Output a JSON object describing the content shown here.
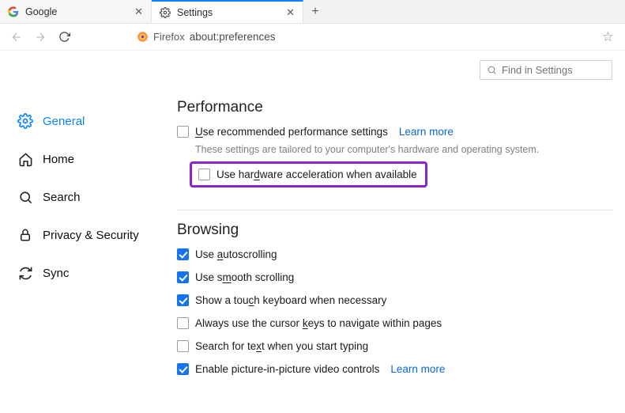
{
  "tabs": [
    {
      "label": "Google",
      "icon": "google"
    },
    {
      "label": "Settings",
      "icon": "gear"
    }
  ],
  "toolbar": {
    "identity_label": "Firefox",
    "url": "about:preferences"
  },
  "find_placeholder": "Find in Settings",
  "sidebar": {
    "items": [
      {
        "label": "General"
      },
      {
        "label": "Home"
      },
      {
        "label": "Search"
      },
      {
        "label": "Privacy & Security"
      },
      {
        "label": "Sync"
      }
    ]
  },
  "performance": {
    "title": "Performance",
    "recommended_label_pre": "",
    "recommended_u": "U",
    "recommended_label_post": "se recommended performance settings",
    "learn_more": "Learn more",
    "desc": "These settings are tailored to your computer's hardware and operating system.",
    "hw_pre": "Use har",
    "hw_u": "d",
    "hw_post": "ware acceleration when available"
  },
  "browsing": {
    "title": "Browsing",
    "auto_pre": "Use ",
    "auto_u": "a",
    "auto_post": "utoscrolling",
    "smooth_pre": "Use s",
    "smooth_u": "m",
    "smooth_post": "ooth scrolling",
    "touch_pre": "Show a tou",
    "touch_u": "c",
    "touch_post": "h keyboard when necessary",
    "cursor_pre": "Always use the cursor ",
    "cursor_u": "k",
    "cursor_post": "eys to navigate within pages",
    "search_pre": "Search for te",
    "search_u": "x",
    "search_post": "t when you start typing",
    "pip_label": "Enable picture-in-picture video controls",
    "learn_more": "Learn more"
  }
}
